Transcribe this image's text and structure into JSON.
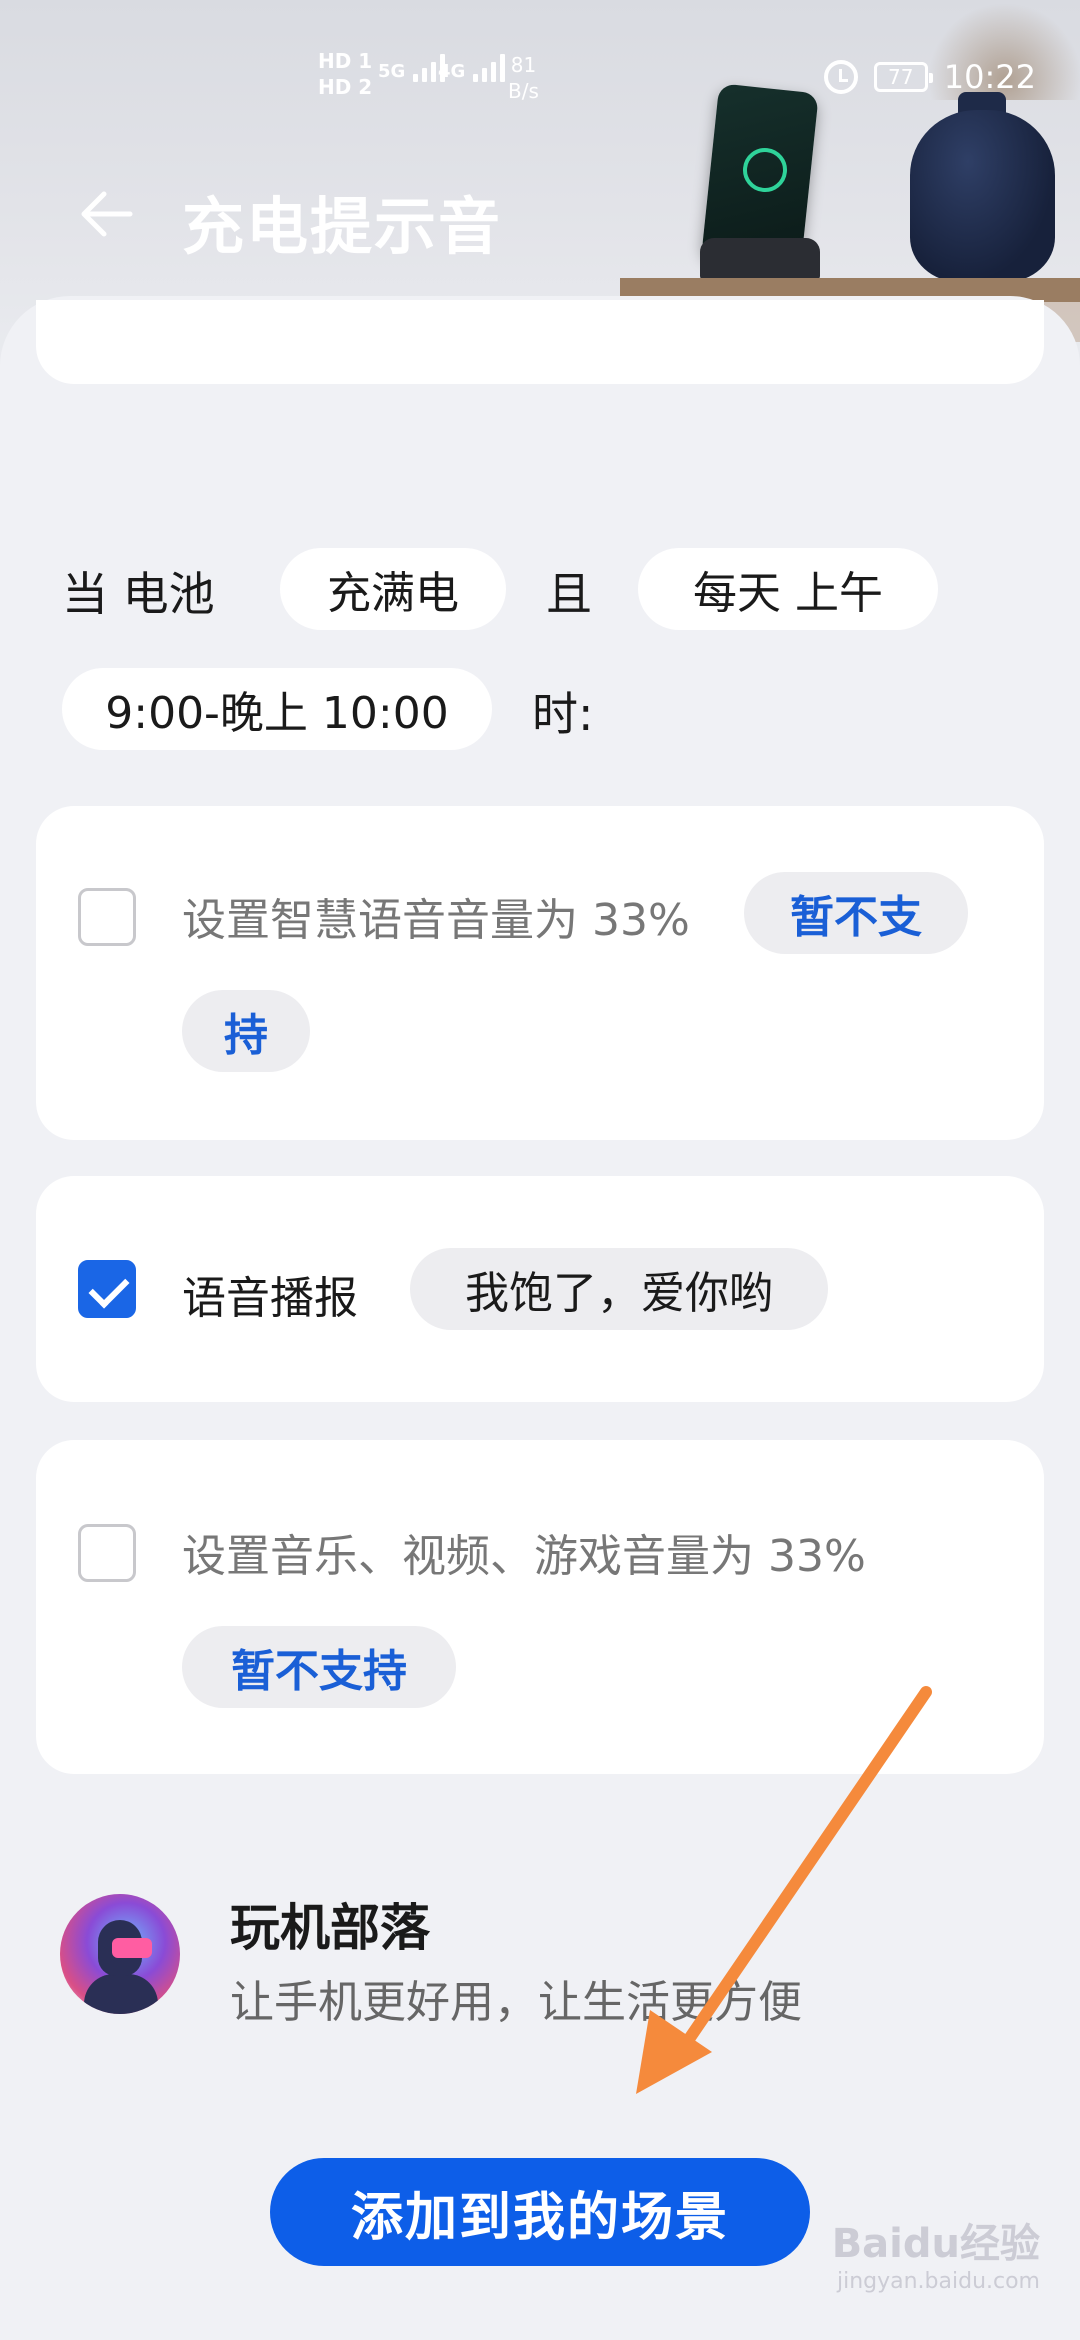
{
  "status_bar": {
    "sim1": "HD 1",
    "sim2": "HD 2",
    "net1": "5G",
    "net2": "4G",
    "speed_value": "81",
    "speed_unit": "B/s",
    "battery": "77",
    "time": "10:22",
    "icons": [
      "alarm-icon",
      "battery-icon"
    ]
  },
  "header": {
    "title": "充电提示音",
    "back_icon": "back-arrow-icon"
  },
  "condition": {
    "prefix": "当 电池",
    "state_chip": "充满电",
    "and": "且",
    "time_chip_line1": "每天 上午",
    "time_chip_line2": "9:00-晚上 10:00",
    "suffix": "时:"
  },
  "actions": [
    {
      "label": "设置智慧语音音量为 33%",
      "chip": "暂不支",
      "chip_cont": "持",
      "checked": false
    },
    {
      "label": "语音播报",
      "chip": "我饱了，爱你哟",
      "checked": true
    },
    {
      "label": "设置音乐、视频、游戏音量为 33%",
      "chip": "暂不支持",
      "checked": false
    }
  ],
  "brand": {
    "name": "玩机部落",
    "tagline": "让手机更好用，让生活更方便"
  },
  "primary_button": "添加到我的场景",
  "watermark": {
    "main": "Baidu经验",
    "sub": "jingyan.baidu.com"
  },
  "colors": {
    "accent": "#0d5ee8",
    "checkbox_on": "#1a66e6",
    "arrow": "#f58a3c",
    "background": "#f0f1f5"
  }
}
